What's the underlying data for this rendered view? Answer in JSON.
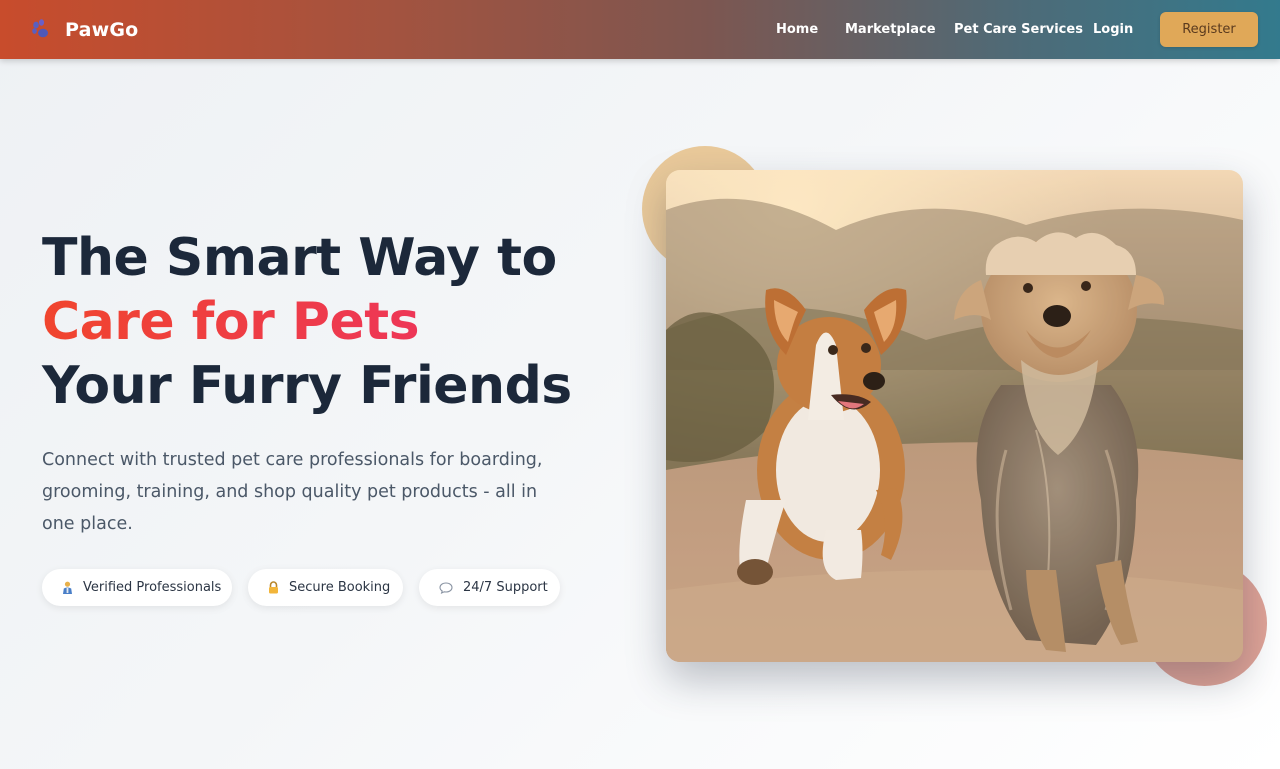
{
  "header": {
    "brand": "PawGo",
    "nav": {
      "home": "Home",
      "marketplace": "Marketplace",
      "services": "Pet Care Services",
      "login": "Login",
      "register": "Register"
    }
  },
  "hero": {
    "title_line1": "The Smart Way to",
    "title_line2": "Care for Pets",
    "title_line3": "Your Furry Friends",
    "description": "Connect with trusted pet care professionals for boarding, grooming, training, and shop quality pet products - all in one place.",
    "badges": [
      {
        "icon": "person-icon",
        "label": "Verified Professionals"
      },
      {
        "icon": "lock-icon",
        "label": "Secure Booking"
      },
      {
        "icon": "chat-icon",
        "label": "24/7 Support"
      }
    ],
    "image": "photo-two-dogs-running"
  },
  "colors": {
    "nav_gradient_start": "#c84c2c",
    "nav_gradient_end": "#337a8d",
    "register_bg": "#e0a858",
    "title": "#1c283a",
    "accent_start": "#f0452e",
    "accent_end": "#ec2f6a",
    "deco_top": "#e9c99a",
    "deco_bottom": "#dfa397"
  }
}
